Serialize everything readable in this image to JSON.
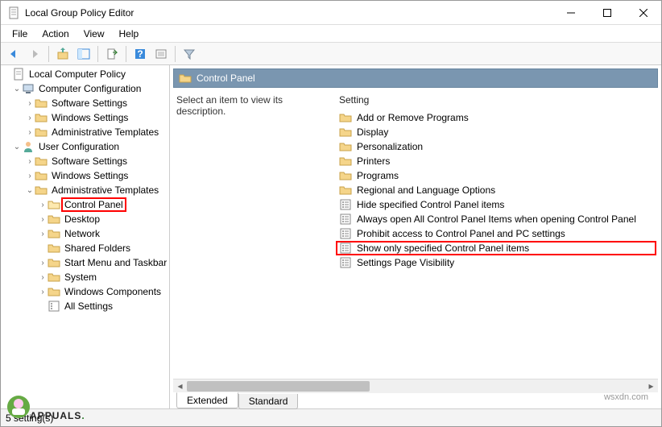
{
  "window": {
    "title": "Local Group Policy Editor"
  },
  "menubar": [
    "File",
    "Action",
    "View",
    "Help"
  ],
  "tree": {
    "root": "Local Computer Policy",
    "computer": {
      "label": "Computer Configuration",
      "children": [
        "Software Settings",
        "Windows Settings",
        "Administrative Templates"
      ]
    },
    "user": {
      "label": "User Configuration",
      "children": [
        "Software Settings",
        "Windows Settings"
      ],
      "admin": {
        "label": "Administrative Templates",
        "children": [
          "Control Panel",
          "Desktop",
          "Network",
          "Shared Folders",
          "Start Menu and Taskbar",
          "System",
          "Windows Components",
          "All Settings"
        ]
      }
    }
  },
  "right": {
    "header": "Control Panel",
    "description": "Select an item to view its description.",
    "column": "Setting",
    "items": [
      {
        "type": "folder",
        "label": "Add or Remove Programs"
      },
      {
        "type": "folder",
        "label": "Display"
      },
      {
        "type": "folder",
        "label": "Personalization"
      },
      {
        "type": "folder",
        "label": "Printers"
      },
      {
        "type": "folder",
        "label": "Programs"
      },
      {
        "type": "folder",
        "label": "Regional and Language Options"
      },
      {
        "type": "setting",
        "label": "Hide specified Control Panel items"
      },
      {
        "type": "setting",
        "label": "Always open All Control Panel Items when opening Control Panel"
      },
      {
        "type": "setting",
        "label": "Prohibit access to Control Panel and PC settings"
      },
      {
        "type": "setting",
        "label": "Show only specified Control Panel items",
        "highlight": true
      },
      {
        "type": "setting",
        "label": "Settings Page Visibility"
      }
    ]
  },
  "tabs": {
    "extended": "Extended",
    "standard": "Standard"
  },
  "status": "5 setting(s)",
  "watermark": "wsxdn.com",
  "brand": "APPUALS"
}
